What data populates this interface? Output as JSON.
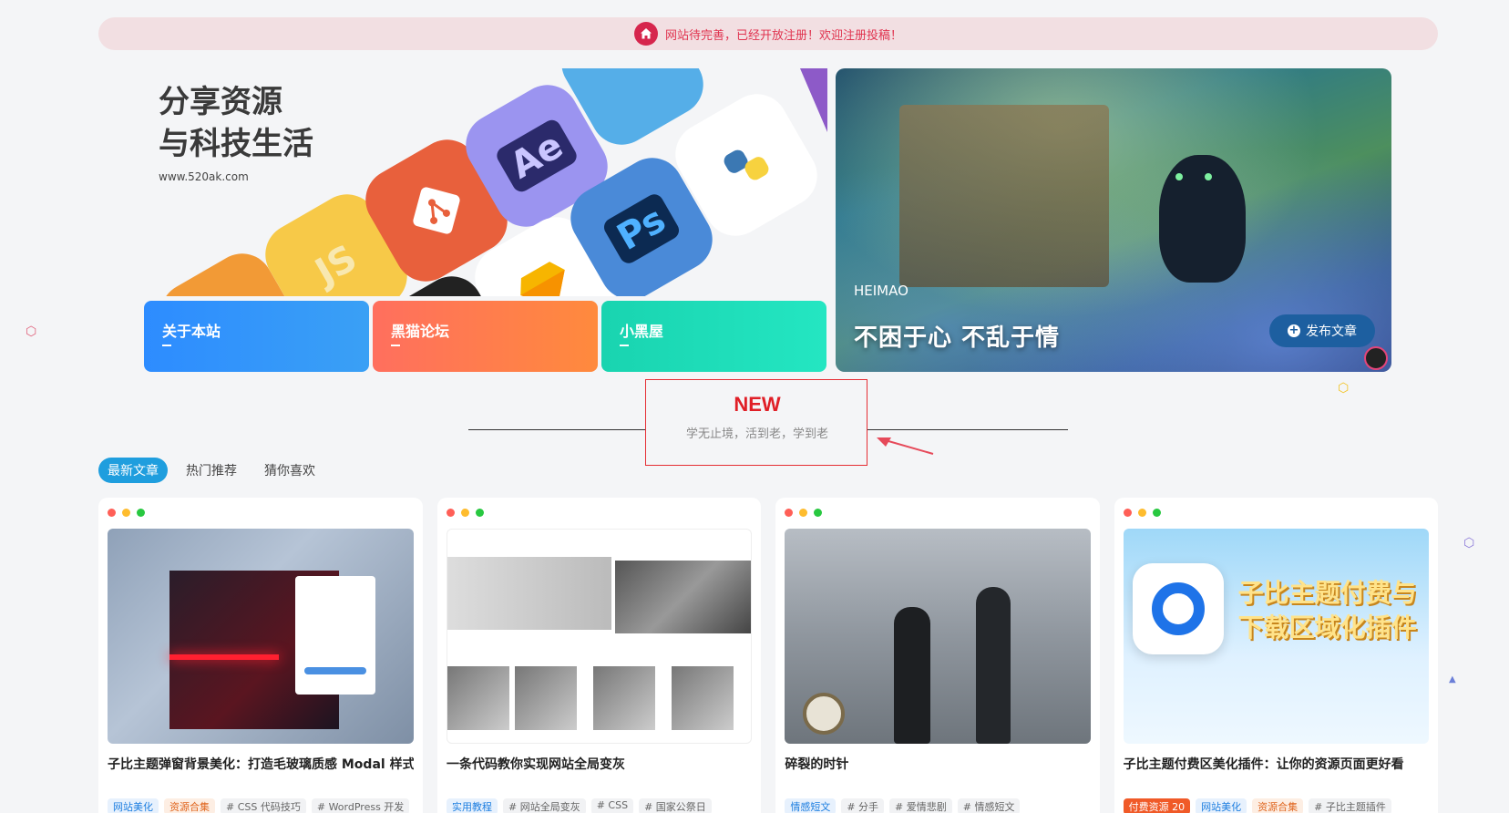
{
  "notice": {
    "text": "网站待完善，已经开放注册！欢迎注册投稿！"
  },
  "hero_left": {
    "slogan_line1": "分享资源",
    "slogan_line2": "与科技生活",
    "url": "www.520ak.com",
    "tiles": [
      "JS",
      "Ae",
      "Ps"
    ]
  },
  "quick_links": [
    {
      "label": "关于本站"
    },
    {
      "label": "黑猫论坛"
    },
    {
      "label": "小黑屋"
    }
  ],
  "hero_right": {
    "brand": "HEIMAO",
    "motto": "不困于心 不乱于情",
    "publish_label": "发布文章"
  },
  "section": {
    "title": "NEW",
    "subtitle": "学无止境，活到老，学到老"
  },
  "tabs": [
    "最新文章",
    "热门推荐",
    "猜你喜欢"
  ],
  "cards": [
    {
      "title": "子比主题弹窗背景美化：打造毛玻璃质感 Modal 样式",
      "tags": [
        {
          "text": "网站美化",
          "style": "blue"
        },
        {
          "text": "资源合集",
          "style": "orange"
        },
        {
          "text": "# CSS 代码技巧",
          "style": "plain"
        },
        {
          "text": "# WordPress 开发",
          "style": "plain"
        }
      ]
    },
    {
      "title": "一条代码教你实现网站全局变灰",
      "tags": [
        {
          "text": "实用教程",
          "style": "blue"
        },
        {
          "text": "# 网站全局变灰",
          "style": "plain"
        },
        {
          "text": "# CSS",
          "style": "plain"
        },
        {
          "text": "# 国家公祭日",
          "style": "plain"
        }
      ]
    },
    {
      "title": "碎裂的时针",
      "tags": [
        {
          "text": "情感短文",
          "style": "blue"
        },
        {
          "text": "# 分手",
          "style": "plain"
        },
        {
          "text": "# 爱情悲剧",
          "style": "plain"
        },
        {
          "text": "# 情感短文",
          "style": "plain"
        }
      ]
    },
    {
      "title": "子比主题付费区美化插件：让你的资源页面更好看",
      "thumb_headline_1": "子比主题付费与",
      "thumb_headline_2": "下载区域化插件",
      "tags": [
        {
          "text": "付费资源 20",
          "style": "red"
        },
        {
          "text": "网站美化",
          "style": "blue"
        },
        {
          "text": "资源合集",
          "style": "orange"
        },
        {
          "text": "# 子比主题插件",
          "style": "plain"
        }
      ]
    }
  ],
  "colors": {
    "accent": "#1f9ede",
    "notice_text": "#e0334f",
    "new_red": "#e01f27"
  }
}
